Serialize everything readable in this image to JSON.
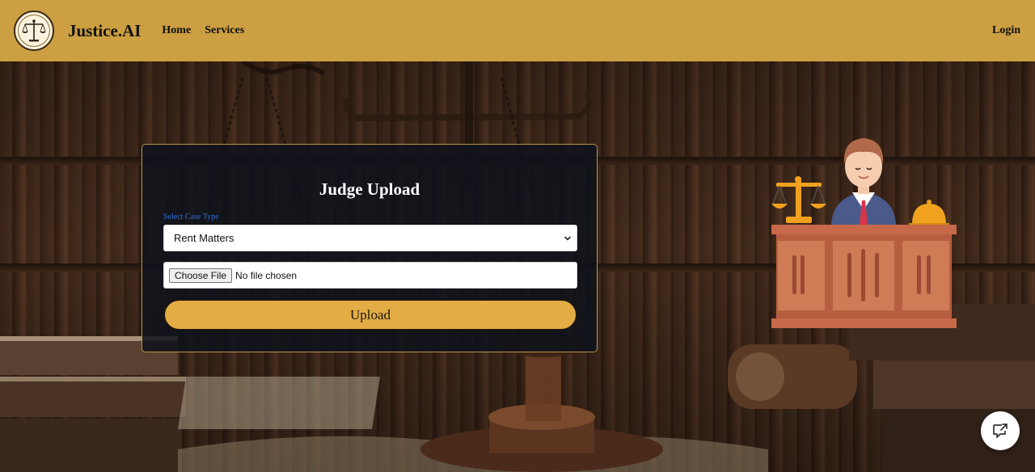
{
  "navbar": {
    "brand": "Justice.AI",
    "links": [
      {
        "label": "Home"
      },
      {
        "label": "Services"
      }
    ],
    "login_label": "Login",
    "background_color": "#cc9f42"
  },
  "upload_card": {
    "title": "Judge Upload",
    "case_type_label": "Select Case Type",
    "case_type_selected": "Rent Matters",
    "file_button_label": "Choose File",
    "file_status": "No file chosen",
    "upload_label": "Upload",
    "accent_color": "#e3ac45"
  },
  "icons": {
    "logo": "scales-of-justice-icon",
    "judge": "judge-illustration",
    "chat": "chat-share-icon",
    "select": "chevron-down-icon"
  }
}
